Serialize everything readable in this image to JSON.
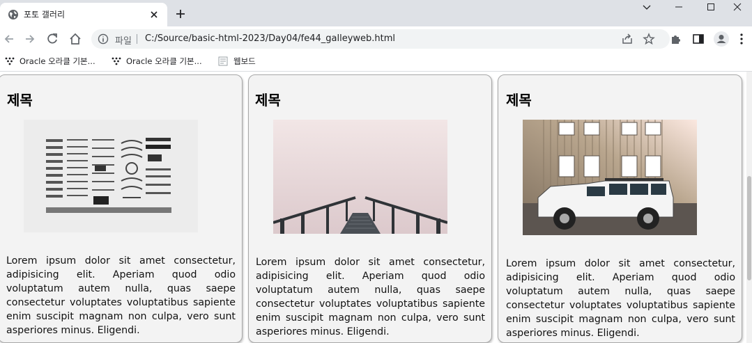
{
  "window": {
    "tab_title": "포토 갤러리",
    "controls": [
      "chevron-down",
      "minimize",
      "maximize",
      "close"
    ]
  },
  "toolbar": {
    "scheme_label": "파일",
    "url": "C:/Source/basic-html-2023/Day04/fe44_galleyweb.html"
  },
  "bookmarks": [
    {
      "label": "Oracle 오라클 기본...",
      "icon": "oracle-dots-icon"
    },
    {
      "label": "Oracle 오라클 기본...",
      "icon": "oracle-dots-icon"
    },
    {
      "label": "웹보드",
      "icon": "page-icon"
    }
  ],
  "gallery": {
    "cards": [
      {
        "heading": "제목",
        "image": "typewriter-parts-flatlay",
        "text": "Lorem ipsum dolor sit amet consectetur, adipisicing elit. Aperiam quod odio voluptatum autem nulla, quas saepe consectetur voluptates voluptatibus sapiente enim suscipit magnam non culpa, vero sunt asperiores minus. Eligendi."
      },
      {
        "heading": "제목",
        "image": "foggy-pier-stairs",
        "text": "Lorem ipsum dolor sit amet consectetur, adipisicing elit. Aperiam quod odio voluptatum autem nulla, quas saepe consectetur voluptates voluptatibus sapiente enim suscipit magnam non culpa, vero sunt asperiores minus. Eligendi."
      },
      {
        "heading": "제목",
        "image": "white-suv-in-front-of-house",
        "text": "Lorem ipsum dolor sit amet consectetur, adipisicing elit. Aperiam quod odio voluptatum autem nulla, quas saepe consectetur voluptates voluptatibus sapiente enim suscipit magnam non culpa, vero sunt asperiores minus. Eligendi."
      }
    ]
  }
}
